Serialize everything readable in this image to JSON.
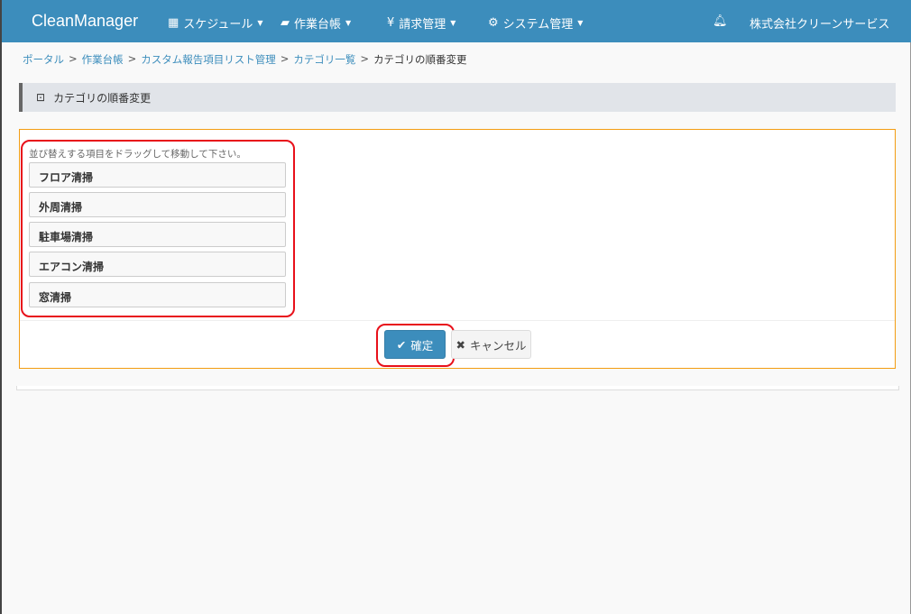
{
  "navbar": {
    "brand": "CleanManager",
    "menus": [
      {
        "icon": "calendar-icon",
        "label": "スケジュール"
      },
      {
        "icon": "book-icon",
        "label": "作業台帳"
      },
      {
        "icon": "yen-icon",
        "label": "請求管理"
      },
      {
        "icon": "gears-icon",
        "label": "システム管理"
      }
    ],
    "company": "株式会社クリーンサービス"
  },
  "breadcrumb": [
    "ポータル",
    "作業台帳",
    "カスタム報告項目リスト管理",
    "カテゴリ一覧",
    "カテゴリの順番変更"
  ],
  "page_title": "カテゴリの順番変更",
  "panel": {
    "hint": "並び替えする項目をドラッグして移動して下さい。",
    "items": [
      "フロア清掃",
      "外周清掃",
      "駐車場清掃",
      "エアコン清掃",
      "窓清掃"
    ],
    "confirm": "確定",
    "cancel": "キャンセル"
  },
  "colors": {
    "navbar": "#3c8dbc",
    "panel_border": "#f39c12",
    "annotation": "#e8101a"
  }
}
